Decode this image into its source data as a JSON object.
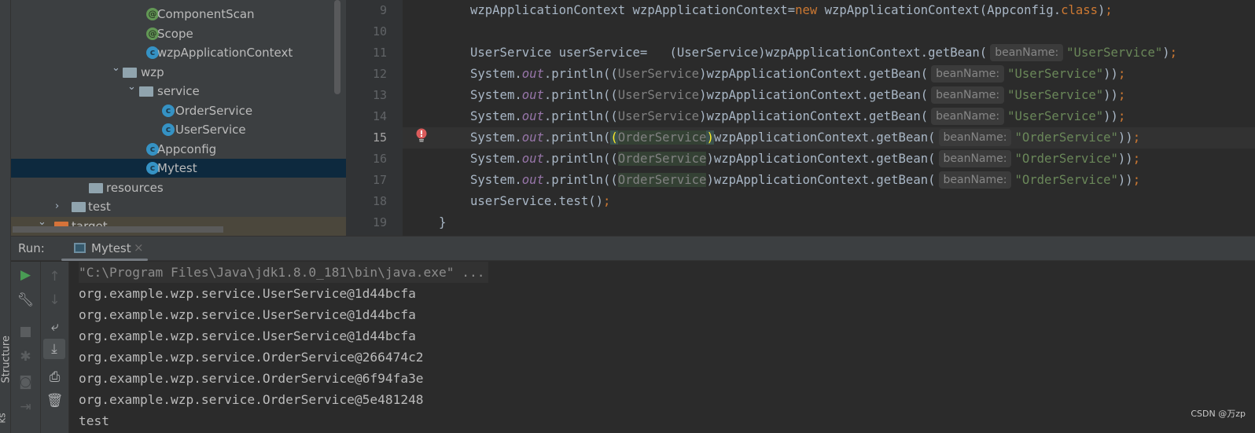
{
  "project_tree": [
    {
      "label": "ComponentScan",
      "icon": "annotation-icon",
      "glyph": "@",
      "kind": "ann"
    },
    {
      "label": "Scope",
      "icon": "annotation-icon",
      "glyph": "@",
      "kind": "ann"
    },
    {
      "label": "wzpApplicationContext",
      "icon": "class-icon",
      "glyph": "c",
      "kind": "cls"
    },
    {
      "label": "wzp",
      "icon": "package-folder-icon",
      "kind": "folder",
      "expanded": true
    },
    {
      "label": "service",
      "icon": "package-folder-icon",
      "kind": "folder",
      "expanded": true
    },
    {
      "label": "OrderService",
      "icon": "class-icon",
      "glyph": "c",
      "kind": "cls"
    },
    {
      "label": "UserService",
      "icon": "class-icon",
      "glyph": "c",
      "kind": "cls"
    },
    {
      "label": "Appconfig",
      "icon": "class-icon",
      "glyph": "c",
      "kind": "cls"
    },
    {
      "label": "Mytest",
      "icon": "runnable-class-icon",
      "glyph": "c",
      "kind": "cls",
      "selected": true
    },
    {
      "label": "resources",
      "icon": "resources-folder-icon",
      "kind": "folder"
    },
    {
      "label": "test",
      "icon": "folder-icon",
      "kind": "folder",
      "expanded": false
    },
    {
      "label": "target",
      "icon": "excluded-folder-icon",
      "kind": "folder",
      "expanded": true,
      "excluded": true
    }
  ],
  "editor": {
    "current_line": 15,
    "lines": [
      {
        "n": "9",
        "tokens": [
          {
            "t": "wzpApplicationContext wzpApplicationContext="
          },
          {
            "t": "new",
            "c": "kw"
          },
          {
            "t": " wzpApplicationContext(Appconfig."
          },
          {
            "t": "class",
            "c": "kw"
          },
          {
            "t": ")"
          },
          {
            "t": ";",
            "c": "kw"
          }
        ]
      },
      {
        "n": "10",
        "tokens": []
      },
      {
        "n": "11",
        "tokens": [
          {
            "t": "UserService userService=   (UserService)wzpApplicationContext.getBean("
          },
          {
            "t": "beanName:",
            "c": "hint"
          },
          {
            "t": "\"UserService\"",
            "c": "str"
          },
          {
            "t": ")"
          },
          {
            "t": ";",
            "c": "kw"
          }
        ]
      },
      {
        "n": "12",
        "tokens": [
          {
            "t": "System."
          },
          {
            "t": "out",
            "c": "it"
          },
          {
            "t": ".println(("
          },
          {
            "t": "UserService",
            "c": "gray"
          },
          {
            "t": ")wzpApplicationContext.getBean("
          },
          {
            "t": "beanName:",
            "c": "hint"
          },
          {
            "t": "\"UserService\"",
            "c": "str"
          },
          {
            "t": "))"
          },
          {
            "t": ";",
            "c": "kw"
          }
        ]
      },
      {
        "n": "13",
        "tokens": [
          {
            "t": "System."
          },
          {
            "t": "out",
            "c": "it"
          },
          {
            "t": ".println(("
          },
          {
            "t": "UserService",
            "c": "gray"
          },
          {
            "t": ")wzpApplicationContext.getBean("
          },
          {
            "t": "beanName:",
            "c": "hint"
          },
          {
            "t": "\"UserService\"",
            "c": "str"
          },
          {
            "t": "))"
          },
          {
            "t": ";",
            "c": "kw"
          }
        ]
      },
      {
        "n": "14",
        "tokens": [
          {
            "t": "System."
          },
          {
            "t": "out",
            "c": "it"
          },
          {
            "t": ".println(("
          },
          {
            "t": "UserService",
            "c": "gray"
          },
          {
            "t": ")wzpApplicationContext.getBean("
          },
          {
            "t": "beanName:",
            "c": "hint"
          },
          {
            "t": "\"UserService\"",
            "c": "str"
          },
          {
            "t": "))"
          },
          {
            "t": ";",
            "c": "kw"
          }
        ]
      },
      {
        "n": "15",
        "tokens": [
          {
            "t": "System."
          },
          {
            "t": "out",
            "c": "it"
          },
          {
            "t": ".println("
          },
          {
            "t": "(",
            "c": "brace"
          },
          {
            "t": "OrderService",
            "c": "gray hl"
          },
          {
            "t": ")",
            "c": "brace"
          },
          {
            "t": "wzpApplicationContext.getBean("
          },
          {
            "t": "beanName:",
            "c": "hint"
          },
          {
            "t": "\"OrderService\"",
            "c": "str"
          },
          {
            "t": "))"
          },
          {
            "t": ";",
            "c": "kw"
          }
        ]
      },
      {
        "n": "16",
        "tokens": [
          {
            "t": "System."
          },
          {
            "t": "out",
            "c": "it"
          },
          {
            "t": ".println(("
          },
          {
            "t": "OrderService",
            "c": "gray hl"
          },
          {
            "t": ")wzpApplicationContext.getBean("
          },
          {
            "t": "beanName:",
            "c": "hint"
          },
          {
            "t": "\"OrderService\"",
            "c": "str"
          },
          {
            "t": "))"
          },
          {
            "t": ";",
            "c": "kw"
          }
        ]
      },
      {
        "n": "17",
        "tokens": [
          {
            "t": "System."
          },
          {
            "t": "out",
            "c": "it"
          },
          {
            "t": ".println(("
          },
          {
            "t": "OrderService",
            "c": "gray hl"
          },
          {
            "t": ")wzpApplicationContext.getBean("
          },
          {
            "t": "beanName:",
            "c": "hint"
          },
          {
            "t": "\"OrderService\"",
            "c": "str"
          },
          {
            "t": "))"
          },
          {
            "t": ";",
            "c": "kw"
          }
        ]
      },
      {
        "n": "18",
        "tokens": [
          {
            "t": "userService.test()"
          },
          {
            "t": ";",
            "c": "kw"
          }
        ]
      },
      {
        "n": "19",
        "indent": "outer",
        "tokens": [
          {
            "t": "}"
          }
        ]
      }
    ]
  },
  "run_panel": {
    "label": "Run:",
    "tab": "Mytest",
    "output": [
      "\"C:\\Program Files\\Java\\jdk1.8.0_181\\bin\\java.exe\" ...",
      "org.example.wzp.service.UserService@1d44bcfa",
      "org.example.wzp.service.UserService@1d44bcfa",
      "org.example.wzp.service.UserService@1d44bcfa",
      "org.example.wzp.service.OrderService@266474c2",
      "org.example.wzp.service.OrderService@6f94fa3e",
      "org.example.wzp.service.OrderService@5e481248",
      "test"
    ]
  },
  "side_labels": {
    "structure": "Structure",
    "bookmarks": "ks"
  },
  "watermark": "CSDN @万zp",
  "colors": {
    "run_green": "#499c54",
    "selection": "#0d293e",
    "error": "#db5c5c"
  }
}
